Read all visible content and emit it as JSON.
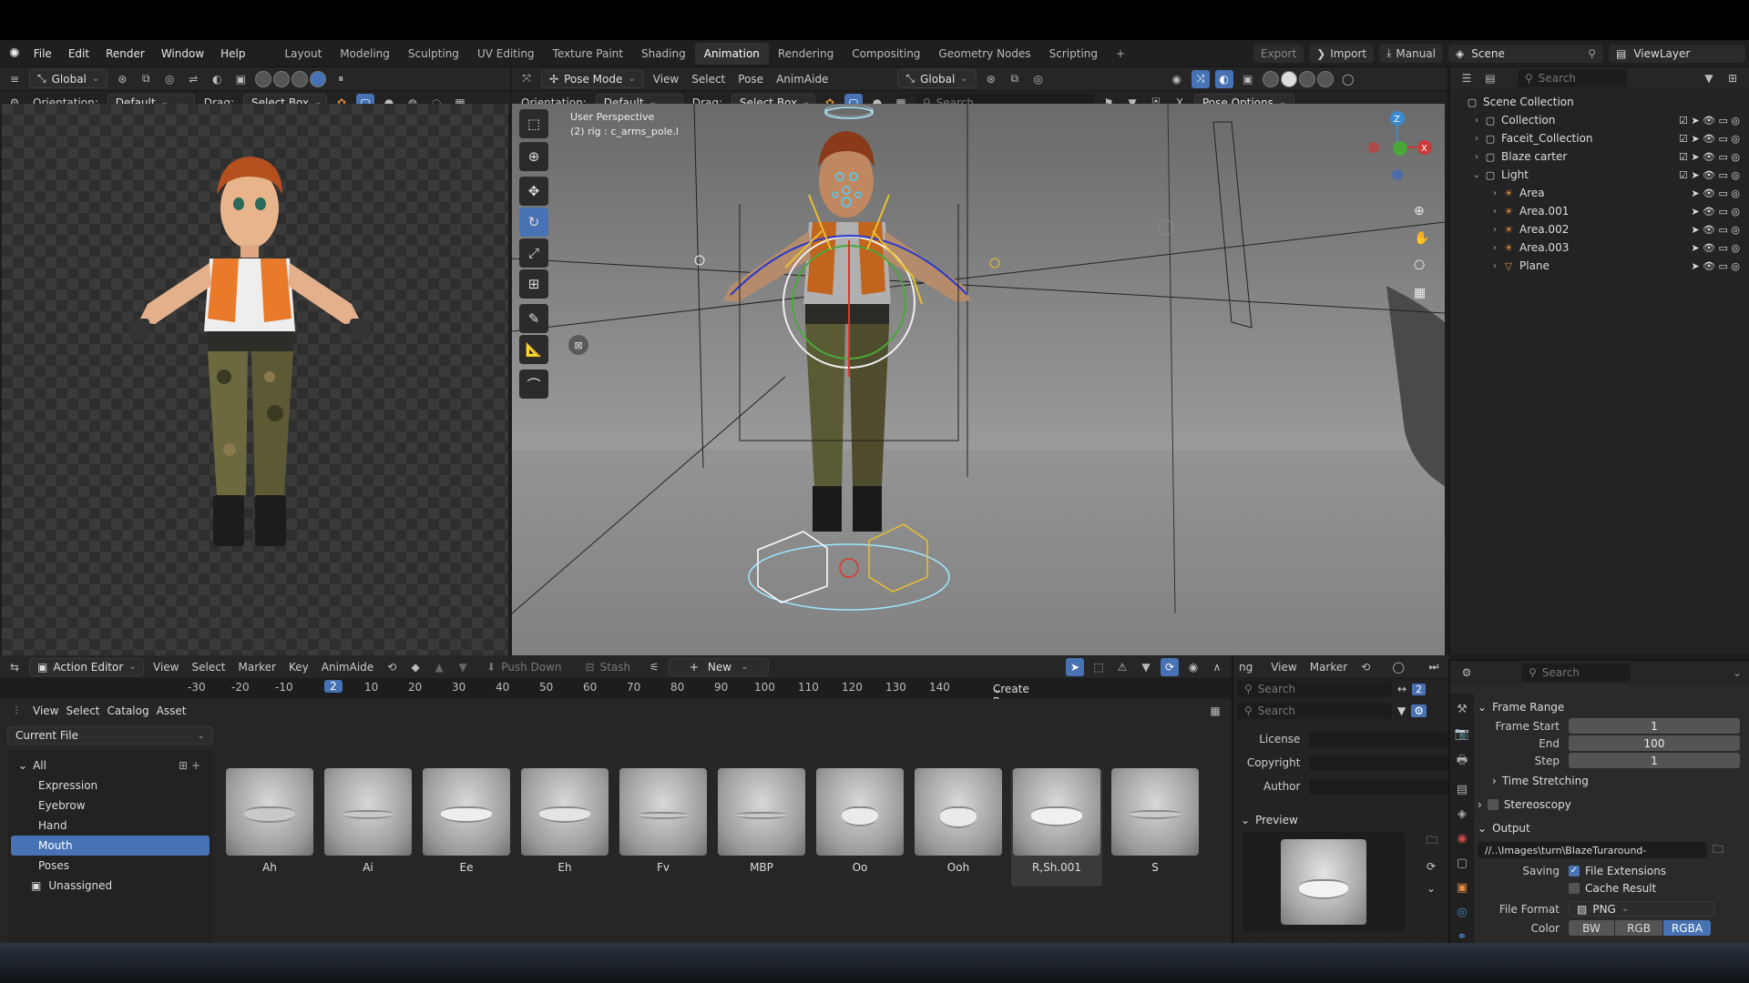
{
  "topbar": {
    "menu": [
      "File",
      "Edit",
      "Render",
      "Window",
      "Help"
    ],
    "workspaces": [
      "Layout",
      "Modeling",
      "Sculpting",
      "UV Editing",
      "Texture Paint",
      "Shading",
      "Animation",
      "Rendering",
      "Compositing",
      "Geometry Nodes",
      "Scripting"
    ],
    "active_workspace": "Animation",
    "export_label": "Export",
    "import_label": "Import",
    "manual_label": "Manual",
    "scene_label": "Scene",
    "viewlayer_label": "ViewLayer"
  },
  "left_header": {
    "transform": "Global",
    "orientation_label": "Orientation:",
    "orientation_value": "Default",
    "drag_label": "Drag:",
    "drag_value": "Select Box"
  },
  "viewport": {
    "mode": "Pose Mode",
    "menus": [
      "View",
      "Select",
      "Pose",
      "AnimAide"
    ],
    "transform": "Global",
    "orientation_label": "Orientation:",
    "orientation_value": "Default",
    "drag_label": "Drag:",
    "drag_value": "Select Box",
    "search_placeholder": "Search",
    "pose_options": "Pose Options",
    "overlay_line1": "User Perspective",
    "overlay_line2": "(2) rig : c_arms_pole.l",
    "gizmo_x": "X",
    "gizmo_z": "Z"
  },
  "outliner": {
    "search_placeholder": "Search",
    "root": "Scene Collection",
    "items": [
      {
        "name": "Collection",
        "indent": 1,
        "expanded": false
      },
      {
        "name": "Faceit_Collection",
        "indent": 1,
        "expanded": false
      },
      {
        "name": "Blaze carter",
        "indent": 1,
        "expanded": false
      },
      {
        "name": "Light",
        "indent": 1,
        "expanded": true
      },
      {
        "name": "Area",
        "indent": 2,
        "expanded": false
      },
      {
        "name": "Area.001",
        "indent": 2,
        "expanded": false
      },
      {
        "name": "Area.002",
        "indent": 2,
        "expanded": false
      },
      {
        "name": "Area.003",
        "indent": 2,
        "expanded": false
      },
      {
        "name": "Plane",
        "indent": 2,
        "expanded": false
      }
    ]
  },
  "properties": {
    "search_placeholder": "Search",
    "frame_range_title": "Frame Range",
    "frame_start_label": "Frame Start",
    "frame_start": "1",
    "end_label": "End",
    "end": "100",
    "step_label": "Step",
    "step": "1",
    "time_stretching": "Time Stretching",
    "stereoscopy": "Stereoscopy",
    "output_title": "Output",
    "output_path": "//..\\Images\\turn\\BlazeTuraround-",
    "saving_label": "Saving",
    "file_extensions": "File Extensions",
    "cache_result": "Cache Result",
    "file_format_label": "File Format",
    "file_format": "PNG",
    "color_label": "Color",
    "color_modes": [
      "BW",
      "RGB",
      "RGBA"
    ],
    "color_active": "RGBA"
  },
  "action_editor": {
    "mode": "Action Editor",
    "menus": [
      "View",
      "Select",
      "Marker",
      "Key",
      "AnimAide"
    ],
    "push_down": "Push Down",
    "stash": "Stash",
    "new_label": "New",
    "ruler": [
      "-30",
      "-20",
      "-10",
      "2",
      "10",
      "20",
      "30",
      "40",
      "50",
      "60",
      "70",
      "80",
      "90",
      "100",
      "110",
      "120",
      "130",
      "140"
    ],
    "current_frame": "2"
  },
  "asset_browser": {
    "menus": [
      "View",
      "Select",
      "Catalog",
      "Asset"
    ],
    "library": "Current File",
    "search_placeholder": "Search",
    "create_pose_asset": "Create Pose Asset",
    "catalogs_root": "All",
    "catalogs": [
      "Expression",
      "Eyebrow",
      "Hand",
      "Mouth",
      "Poses"
    ],
    "unassigned": "Unassigned",
    "selected_catalog": "Mouth",
    "assets": [
      "Ah",
      "Ai",
      "Ee",
      "Eh",
      "Fv",
      "MBP",
      "Oo",
      "Ooh",
      "R,Sh.001",
      "S"
    ],
    "selected_asset": "R,Sh.001"
  },
  "side_panel": {
    "menus": [
      "View",
      "Marker"
    ],
    "tab_fragment": "ng",
    "search_placeholder": "Search",
    "license_label": "License",
    "copyright_label": "Copyright",
    "author_label": "Author",
    "preview_title": "Preview"
  }
}
